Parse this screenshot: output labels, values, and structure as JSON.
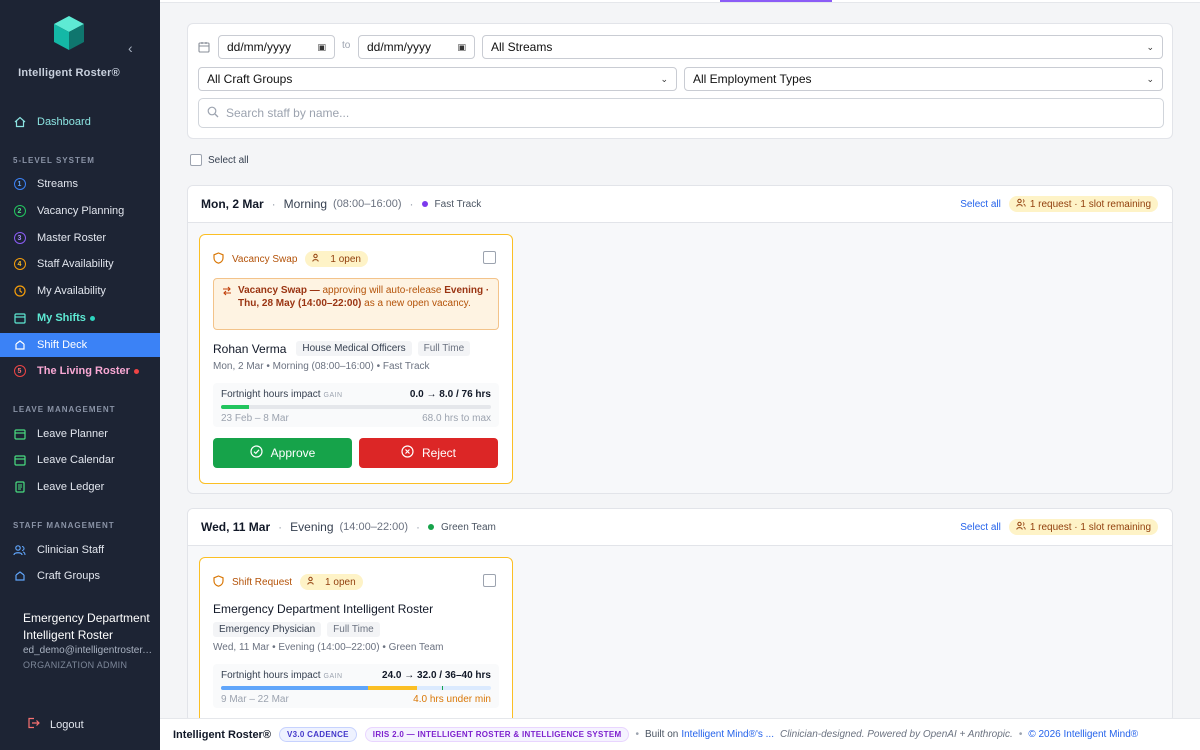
{
  "app": {
    "brand": "Intelligent Roster®"
  },
  "nav": {
    "dashboard": "Dashboard",
    "section_levels": "5-LEVEL SYSTEM",
    "levels": [
      {
        "num": "1",
        "label": "Streams",
        "color": "#3b82f6"
      },
      {
        "num": "2",
        "label": "Vacancy Planning",
        "color": "#22c55e"
      },
      {
        "num": "3",
        "label": "Master Roster",
        "color": "#8b5cf6"
      },
      {
        "num": "4",
        "label": "Staff Availability",
        "color": "#f59e0b"
      }
    ],
    "my_availability": "My Availability",
    "my_shifts": "My Shifts",
    "shift_deck": "Shift Deck",
    "living_roster_num": "5",
    "living_roster": "The Living Roster",
    "section_leave": "LEAVE MANAGEMENT",
    "leave_planner": "Leave Planner",
    "leave_calendar": "Leave Calendar",
    "leave_ledger": "Leave Ledger",
    "section_staff": "STAFF MANAGEMENT",
    "clinician_staff": "Clinician Staff",
    "craft_groups": "Craft Groups"
  },
  "user": {
    "name": "Emergency Department Intelligent Roster",
    "email": "ed_demo@intelligentroster.com",
    "role": "ORGANIZATION ADMIN"
  },
  "logout": "Logout",
  "filters": {
    "date_from_placeholder": "dd/mm/yyyy",
    "to_label": "to",
    "date_to_placeholder": "dd/mm/yyyy",
    "streams": "All Streams",
    "craft_groups": "All Craft Groups",
    "employment_types": "All Employment Types",
    "search_placeholder": "Search staff by name..."
  },
  "select_all": "Select all",
  "groups": [
    {
      "date": "Mon, 2 Mar",
      "shift": "Morning",
      "time": "(08:00–16:00)",
      "team": "Fast Track",
      "team_color": "#7c3aed",
      "select_all": "Select all",
      "pill": "1 request · 1 slot remaining",
      "card": {
        "type": "Vacancy Swap",
        "open": "1 open",
        "notice_bold1": "Vacancy Swap —",
        "notice_text1": " approving will auto-release ",
        "notice_bold2": "Evening · Thu, 28 May (14:00–22:00)",
        "notice_text2": " as a new open vacancy.",
        "name": "Rohan Verma",
        "craft": "House Medical Officers",
        "employment": "Full Time",
        "meta": "Mon, 2 Mar • Morning (08:00–16:00) • Fast Track",
        "hours_label": "Fortnight hours impact",
        "hours_tag": "GAIN",
        "hours_value": "0.0 → 8.0 / 76 hrs",
        "hours_fill": 0.105,
        "period": "23 Feb – 8 Mar",
        "period_note": "68.0 hrs to max",
        "approve": "Approve",
        "reject": "Reject"
      }
    },
    {
      "date": "Wed, 11 Mar",
      "shift": "Evening",
      "time": "(14:00–22:00)",
      "team": "Green Team",
      "team_color": "#16a34a",
      "select_all": "Select all",
      "pill": "1 request · 1 slot remaining",
      "card": {
        "type": "Shift Request",
        "open": "1 open",
        "name": "Emergency Department Intelligent Roster",
        "craft": "Emergency Physician",
        "employment": "Full Time",
        "meta": "Wed, 11 Mar • Evening (14:00–22:00) • Green Team",
        "hours_label": "Fortnight hours impact",
        "hours_tag": "GAIN",
        "hours_value": "24.0 → 32.0 / 36–40 hrs",
        "hours_current": 24.0,
        "hours_new": 32.0,
        "period": "9 Mar – 22 Mar",
        "period_note": "4.0 hrs under min"
      }
    }
  ],
  "footer": {
    "brand": "Intelligent Roster®",
    "badge1": "V3.0 CADENCE",
    "badge2": "IRIS 2.0 — INTELLIGENT ROSTER & INTELLIGENCE SYSTEM",
    "built_on": "Built on ",
    "built_link": "Intelligent Mind®'s ...",
    "credit": "Clinician-designed. Powered by OpenAI + Anthropic.",
    "copyright": "© 2026 Intelligent Mind®"
  },
  "colors": {
    "accent": "#3b82f6",
    "sidebar_bg": "#1d2434",
    "approve": "#16a34a",
    "reject": "#dc2626",
    "warning": "#fbbf24"
  }
}
